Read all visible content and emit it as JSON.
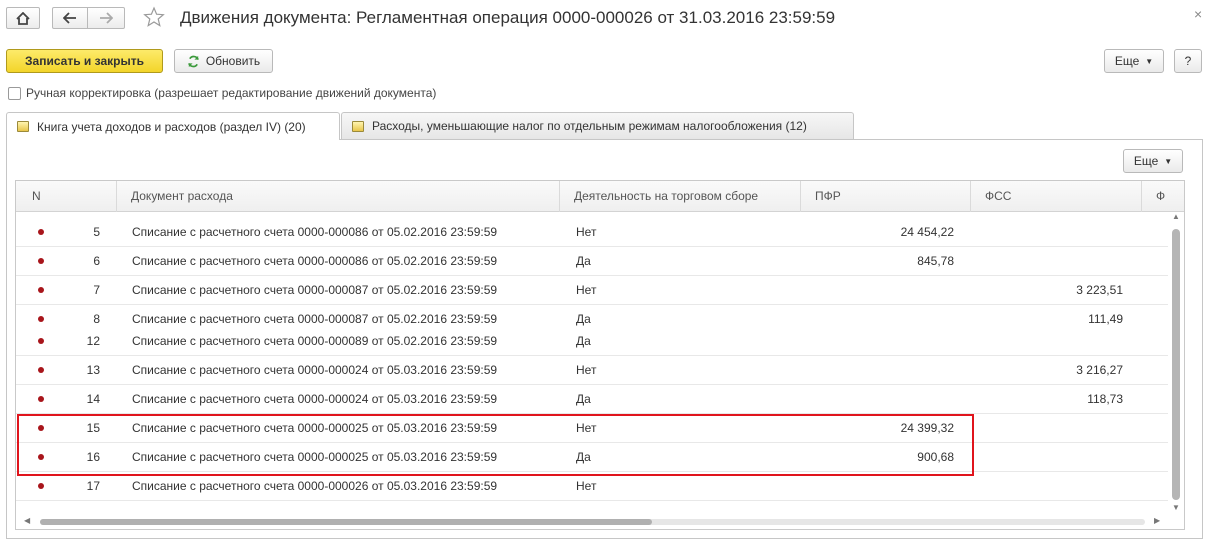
{
  "window": {
    "title": "Движения документа: Регламентная операция 0000-000026 от 31.03.2016 23:59:59",
    "close_glyph": "×"
  },
  "nav": {
    "home_icon": "home-icon",
    "back_icon": "arrow-left-icon",
    "forward_icon": "arrow-right-icon",
    "favorite_icon": "star-icon"
  },
  "toolbar": {
    "save_close_label": "Записать и закрыть",
    "refresh_label": "Обновить",
    "more_label": "Еще",
    "help_label": "?"
  },
  "manual_edit": {
    "label": "Ручная корректировка (разрешает редактирование движений документа)",
    "checked": false
  },
  "tabs": [
    {
      "label": "Книга учета доходов и расходов (раздел IV) (20)",
      "active": true
    },
    {
      "label": "Расходы, уменьшающие налог по отдельным режимам налогообложения (12)",
      "active": false
    }
  ],
  "grid": {
    "more_label": "Еще",
    "columns": [
      "N",
      "Документ расхода",
      "Деятельность на торговом сборе",
      "ПФР",
      "ФСС",
      "Ф"
    ],
    "rows": [
      {
        "n": "5",
        "doc": "Списание с расчетного счета 0000-000086 от 05.02.2016 23:59:59",
        "trade": "Нет",
        "pfr": "24 454,22",
        "fss": ""
      },
      {
        "n": "6",
        "doc": "Списание с расчетного счета 0000-000086 от 05.02.2016 23:59:59",
        "trade": "Да",
        "pfr": "845,78",
        "fss": ""
      },
      {
        "n": "7",
        "doc": "Списание с расчетного счета 0000-000087 от 05.02.2016 23:59:59",
        "trade": "Нет",
        "pfr": "",
        "fss": "3 223,51"
      },
      {
        "n": "8",
        "doc": "Списание с расчетного счета 0000-000087 от 05.02.2016 23:59:59",
        "trade": "Да",
        "pfr": "",
        "fss": "111,49"
      },
      {
        "n": "12",
        "doc": "Списание с расчетного счета 0000-000089 от 05.02.2016 23:59:59",
        "trade": "Да",
        "pfr": "",
        "fss": ""
      },
      {
        "n": "13",
        "doc": "Списание с расчетного счета 0000-000024 от 05.03.2016 23:59:59",
        "trade": "Нет",
        "pfr": "",
        "fss": "3 216,27"
      },
      {
        "n": "14",
        "doc": "Списание с расчетного счета 0000-000024 от 05.03.2016 23:59:59",
        "trade": "Да",
        "pfr": "",
        "fss": "118,73"
      },
      {
        "n": "15",
        "doc": "Списание с расчетного счета 0000-000025 от 05.03.2016 23:59:59",
        "trade": "Нет",
        "pfr": "24 399,32",
        "fss": ""
      },
      {
        "n": "16",
        "doc": "Списание с расчетного счета 0000-000025 от 05.03.2016 23:59:59",
        "trade": "Да",
        "pfr": "900,68",
        "fss": ""
      },
      {
        "n": "17",
        "doc": "Списание с расчетного счета 0000-000026 от 05.03.2016 23:59:59",
        "trade": "Нет",
        "pfr": "",
        "fss": ""
      }
    ],
    "highlighted_rows": [
      "15",
      "16"
    ]
  },
  "colors": {
    "primary_button": "#f3d52a",
    "row_marker": "#a8151b",
    "highlight_border": "#e0141c",
    "refresh_icon": "#3c9a3c"
  }
}
